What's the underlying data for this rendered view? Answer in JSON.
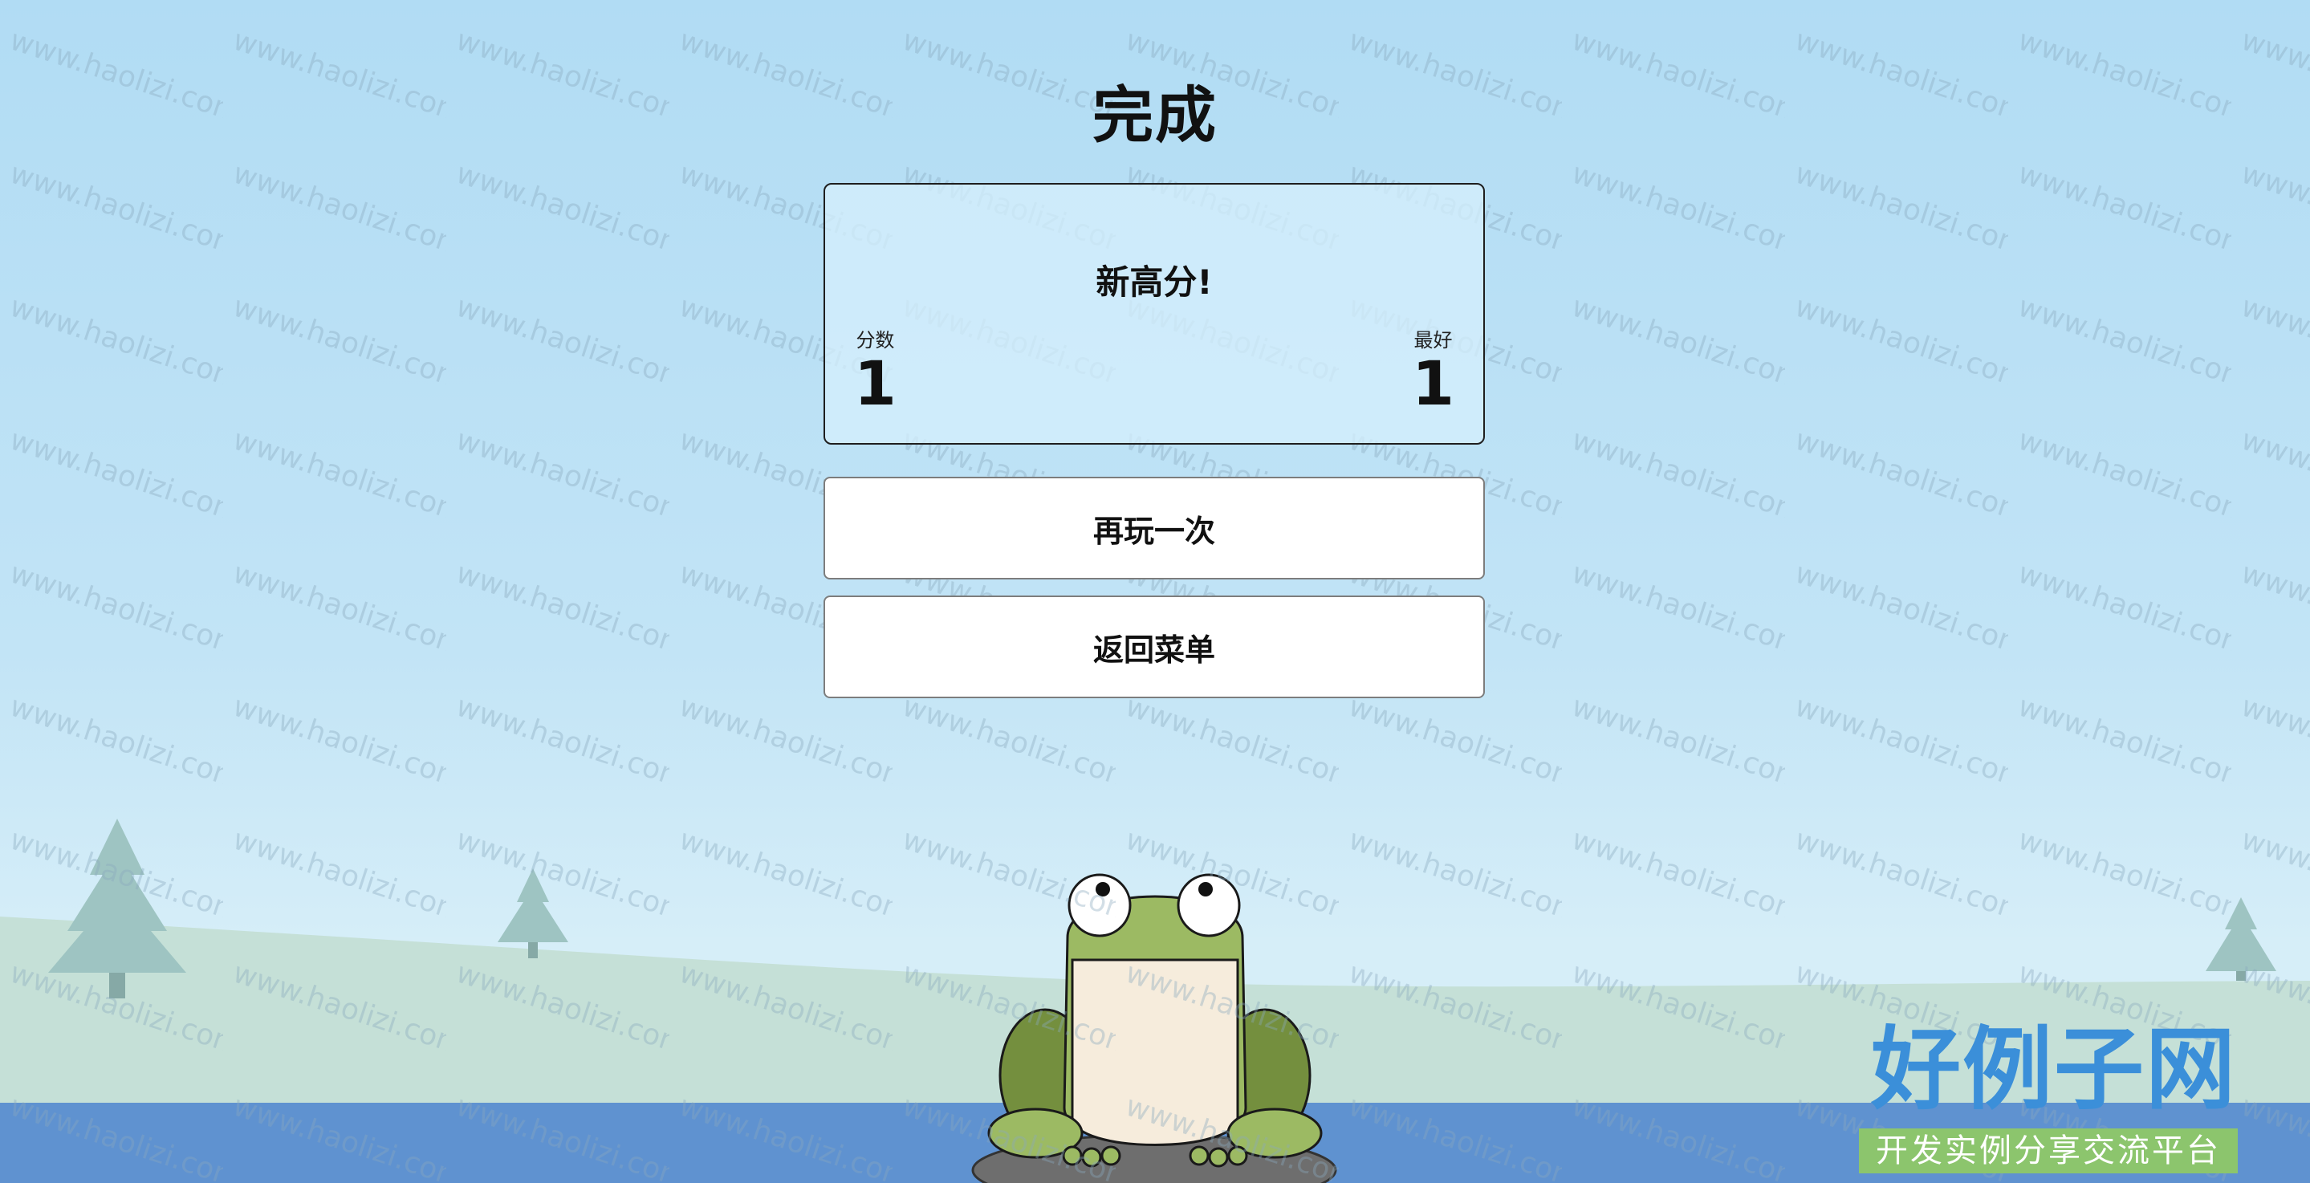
{
  "title": "完成",
  "result": {
    "banner": "新高分!",
    "score_label": "分数",
    "score_value": "1",
    "best_label": "最好",
    "best_value": "1"
  },
  "buttons": {
    "play_again": "再玩一次",
    "back_to_menu": "返回菜单"
  },
  "watermark": {
    "tile_text": "www.haolizi.com",
    "logo_text": "好例子网",
    "logo_subtitle": "开发实例分享交流平台"
  },
  "colors": {
    "sky": "#b1dcf4",
    "hill": "#c5e0d7",
    "water": "#5f92d0",
    "frog_green": "#9cba63",
    "frog_dark": "#748f3e",
    "frog_belly": "#f6ecdc",
    "rock": "#6e6e6e",
    "tree": "#9ec4c2"
  }
}
